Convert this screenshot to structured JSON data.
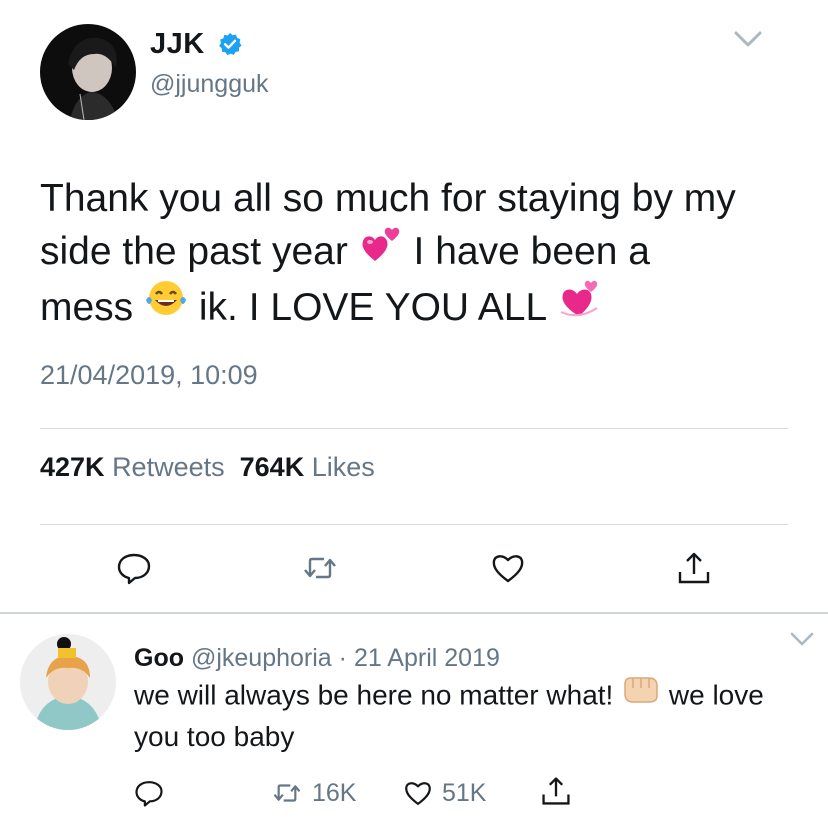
{
  "tweet": {
    "display_name": "JJK",
    "handle": "@jjungguk",
    "text_line1": "Thank you all so much for staying by my",
    "text_line2_a": "side the past year",
    "text_line2_b": "I have been a",
    "text_line3_a": "mess",
    "text_line3_b": "ik. I LOVE YOU ALL",
    "timestamp": "21/04/2019, 10:09",
    "retweets_count": "427K",
    "retweets_label": "Retweets",
    "likes_count": "764K",
    "likes_label": "Likes",
    "emojis": [
      "two-hearts-emoji",
      "tears-of-joy-emoji",
      "revolving-hearts-emoji"
    ],
    "verified_color": "#1da1f2"
  },
  "reply": {
    "display_name": "Goo",
    "handle": "@jkeuphoria",
    "separator": "·",
    "date": "21 April 2019",
    "text_a": "we will always be here no matter what!",
    "text_b": "we love you too baby",
    "retweets": "16K",
    "likes": "51K",
    "emoji": "oncoming-fist-emoji"
  },
  "colors": {
    "primary_text": "#14171a",
    "secondary_text": "#657786",
    "divider": "#d6dbdf",
    "heart_pink": "#e8288a"
  }
}
